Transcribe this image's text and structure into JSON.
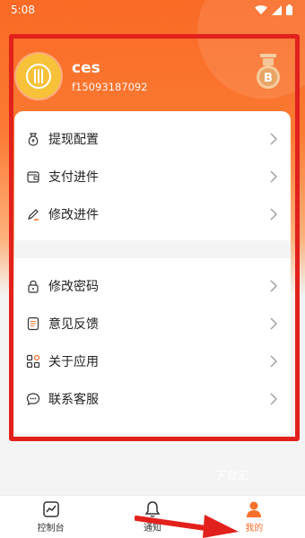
{
  "status_bar": {
    "time": "5:08",
    "icons": [
      "wifi-icon",
      "signal-icon",
      "battery-icon"
    ]
  },
  "profile": {
    "name": "ces",
    "user_id": "f15093187092",
    "badge_letter": "B"
  },
  "menu": {
    "group1": [
      {
        "label": "提现配置",
        "icon": "money-bag-icon"
      },
      {
        "label": "支付进件",
        "icon": "wallet-icon"
      },
      {
        "label": "修改进件",
        "icon": "pen-icon"
      }
    ],
    "group2": [
      {
        "label": "修改密码",
        "icon": "lock-icon"
      },
      {
        "label": "意见反馈",
        "icon": "feedback-icon"
      },
      {
        "label": "关于应用",
        "icon": "apps-icon"
      },
      {
        "label": "联系客服",
        "icon": "chat-icon"
      }
    ]
  },
  "footer": {
    "watermark": "下载汇"
  },
  "tabs": [
    {
      "label": "控制台",
      "icon": "chart-icon",
      "active": false
    },
    {
      "label": "通知",
      "icon": "bell-icon",
      "active": false
    },
    {
      "label": "我的",
      "icon": "person-icon",
      "active": true
    }
  ],
  "colors": {
    "accent": "#f7702b",
    "annotation": "#e2211c",
    "header": "#f96a25"
  }
}
